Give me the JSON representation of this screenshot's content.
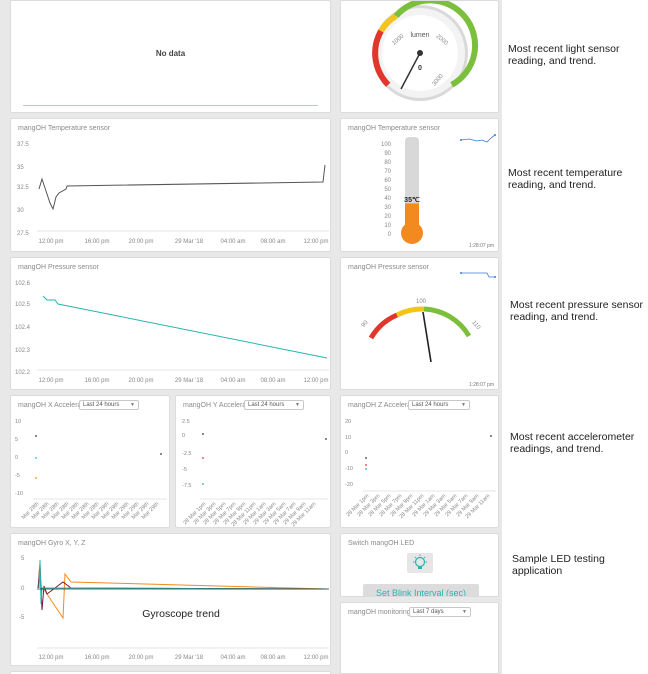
{
  "colors": {
    "teal": "#26b5b0",
    "dark_line": "#555555",
    "orange": "#f28a1f",
    "gauge_green": "#7bbf3c",
    "gauge_red": "#e0362c",
    "gauge_yellow": "#f2c41c"
  },
  "light": {
    "no_data": "No data",
    "gauge_unit": "lumen",
    "gauge_ticks": [
      "0",
      "1000",
      "2000",
      "3000"
    ],
    "note": "Most recent light sensor reading, and trend."
  },
  "temp_chart": {
    "title": "mangOH Temperature sensor",
    "yticks": [
      "37.5",
      "35",
      "32.5",
      "30",
      "27.5"
    ],
    "xticks": [
      "12:00 pm",
      "16:00 pm",
      "20:00 pm",
      "29 Mar '18",
      "04:00 am",
      "08:00 am",
      "12:00 pm"
    ]
  },
  "temp_widget": {
    "title": "mangOH Temperature sensor",
    "scale": [
      "100",
      "90",
      "80",
      "70",
      "60",
      "50",
      "40",
      "30",
      "20",
      "10",
      "0"
    ],
    "value_label": "35℃",
    "level": 0.35,
    "timestamp": "1:28:07 pm"
  },
  "temp_note": "Most recent temperature reading, and trend.",
  "pressure_chart": {
    "title": "mangOH Pressure sensor",
    "yticks": [
      "102.6",
      "102.5",
      "102.4",
      "102.3",
      "102.2"
    ],
    "xticks": [
      "12:00 pm",
      "16:00 pm",
      "20:00 pm",
      "29 Mar '18",
      "04:00 am",
      "08:00 am",
      "12:00 pm"
    ]
  },
  "pressure_widget": {
    "title": "mangOH Pressure sensor",
    "ticks": [
      "90",
      "100",
      "110"
    ],
    "timestamp": "1:28:07 pm"
  },
  "pressure_note": "Most recent pressure sensor reading, and trend.",
  "accel": {
    "x": {
      "title": "mangOH X Accelera",
      "range": "Last 24 hours",
      "yticks": [
        "10",
        "5",
        "0",
        "-5",
        "-10"
      ],
      "xticks": [
        "Mar 28th",
        "Mar 28th",
        "Mar 28th",
        "Mar 28th",
        "Mar 28th",
        "Mar 28th",
        "Mar 28th",
        "Mar 29th",
        "Mar 29th",
        "Mar 29th",
        "Mar 29th",
        "Mar 29th",
        "Mar 29th"
      ]
    },
    "y": {
      "title": "mangOH Y Accelera",
      "range": "Last 24 hours",
      "yticks": [
        "2.5",
        "0",
        "-2.5",
        "-5",
        "-7.5"
      ],
      "xticks": [
        "28 Mar 1pm",
        "28 Mar 3pm",
        "28 Mar 5pm",
        "28 Mar 7pm",
        "28 Mar 9pm",
        "28 Mar 11pm",
        "29 Mar 1am",
        "29 Mar 3am",
        "29 Mar 5am",
        "29 Mar 7am",
        "29 Mar 9am",
        "29 Mar 11am"
      ]
    },
    "z": {
      "title": "mangOH Z Accelera",
      "range": "Last 24 hours",
      "yticks": [
        "20",
        "10",
        "0",
        "-10",
        "-20"
      ],
      "xticks": [
        "28 Mar 1pm",
        "28 Mar 3pm",
        "28 Mar 5pm",
        "28 Mar 7pm",
        "28 Mar 9pm",
        "28 Mar 11pm",
        "29 Mar 1am",
        "29 Mar 3am",
        "29 Mar 5am",
        "29 Mar 7am",
        "29 Mar 9am",
        "29 Mar 11am"
      ]
    }
  },
  "accel_note": "Most recent accelerometer readings, and trend.",
  "gyro": {
    "title": "mangOH Gyro X, Y, Z",
    "yticks": [
      "5",
      "0",
      "-5"
    ],
    "xticks": [
      "12:00 pm",
      "16:00 pm",
      "20:00 pm",
      "29 Mar '18",
      "04:00 am",
      "08:00 am",
      "12:00 pm"
    ],
    "annotation": "Gyroscope trend"
  },
  "led": {
    "title": "Switch mangOH LED",
    "button": "Set Blink Interval (sec)",
    "note": "Sample LED testing application"
  },
  "monitoring": {
    "title": "mangOH monitoring",
    "range": "Last 7 days"
  }
}
